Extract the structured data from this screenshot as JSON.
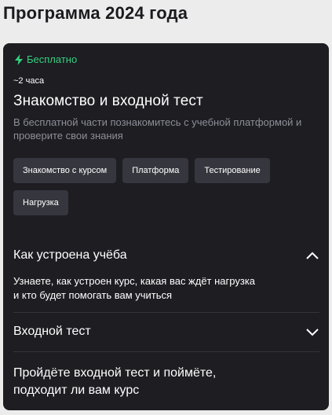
{
  "page": {
    "title": "Программа 2024 года"
  },
  "module": {
    "badge": {
      "label": "Бесплатно",
      "icon": "lightning-icon",
      "color": "#35d07f"
    },
    "duration": "~2 часа",
    "title": "Знакомство и входной тест",
    "description": "В бесплатной части познакомитесь с учебной платформой и проверите свои знания",
    "tags": [
      "Знакомство с курсом",
      "Платформа",
      "Тестирование",
      "Нагрузка"
    ]
  },
  "accordion": [
    {
      "title": "Как устроена учёба",
      "expanded": true,
      "text_lines": [
        "Узнаете, как устроен курс, какая вас ждёт нагрузка",
        "и кто будет помогать вам учиться"
      ]
    },
    {
      "title": "Входной тест",
      "expanded": false
    }
  ],
  "closing_text_lines": [
    "Пройдёте входной тест и поймёте,",
    "подходит ли вам курс"
  ]
}
